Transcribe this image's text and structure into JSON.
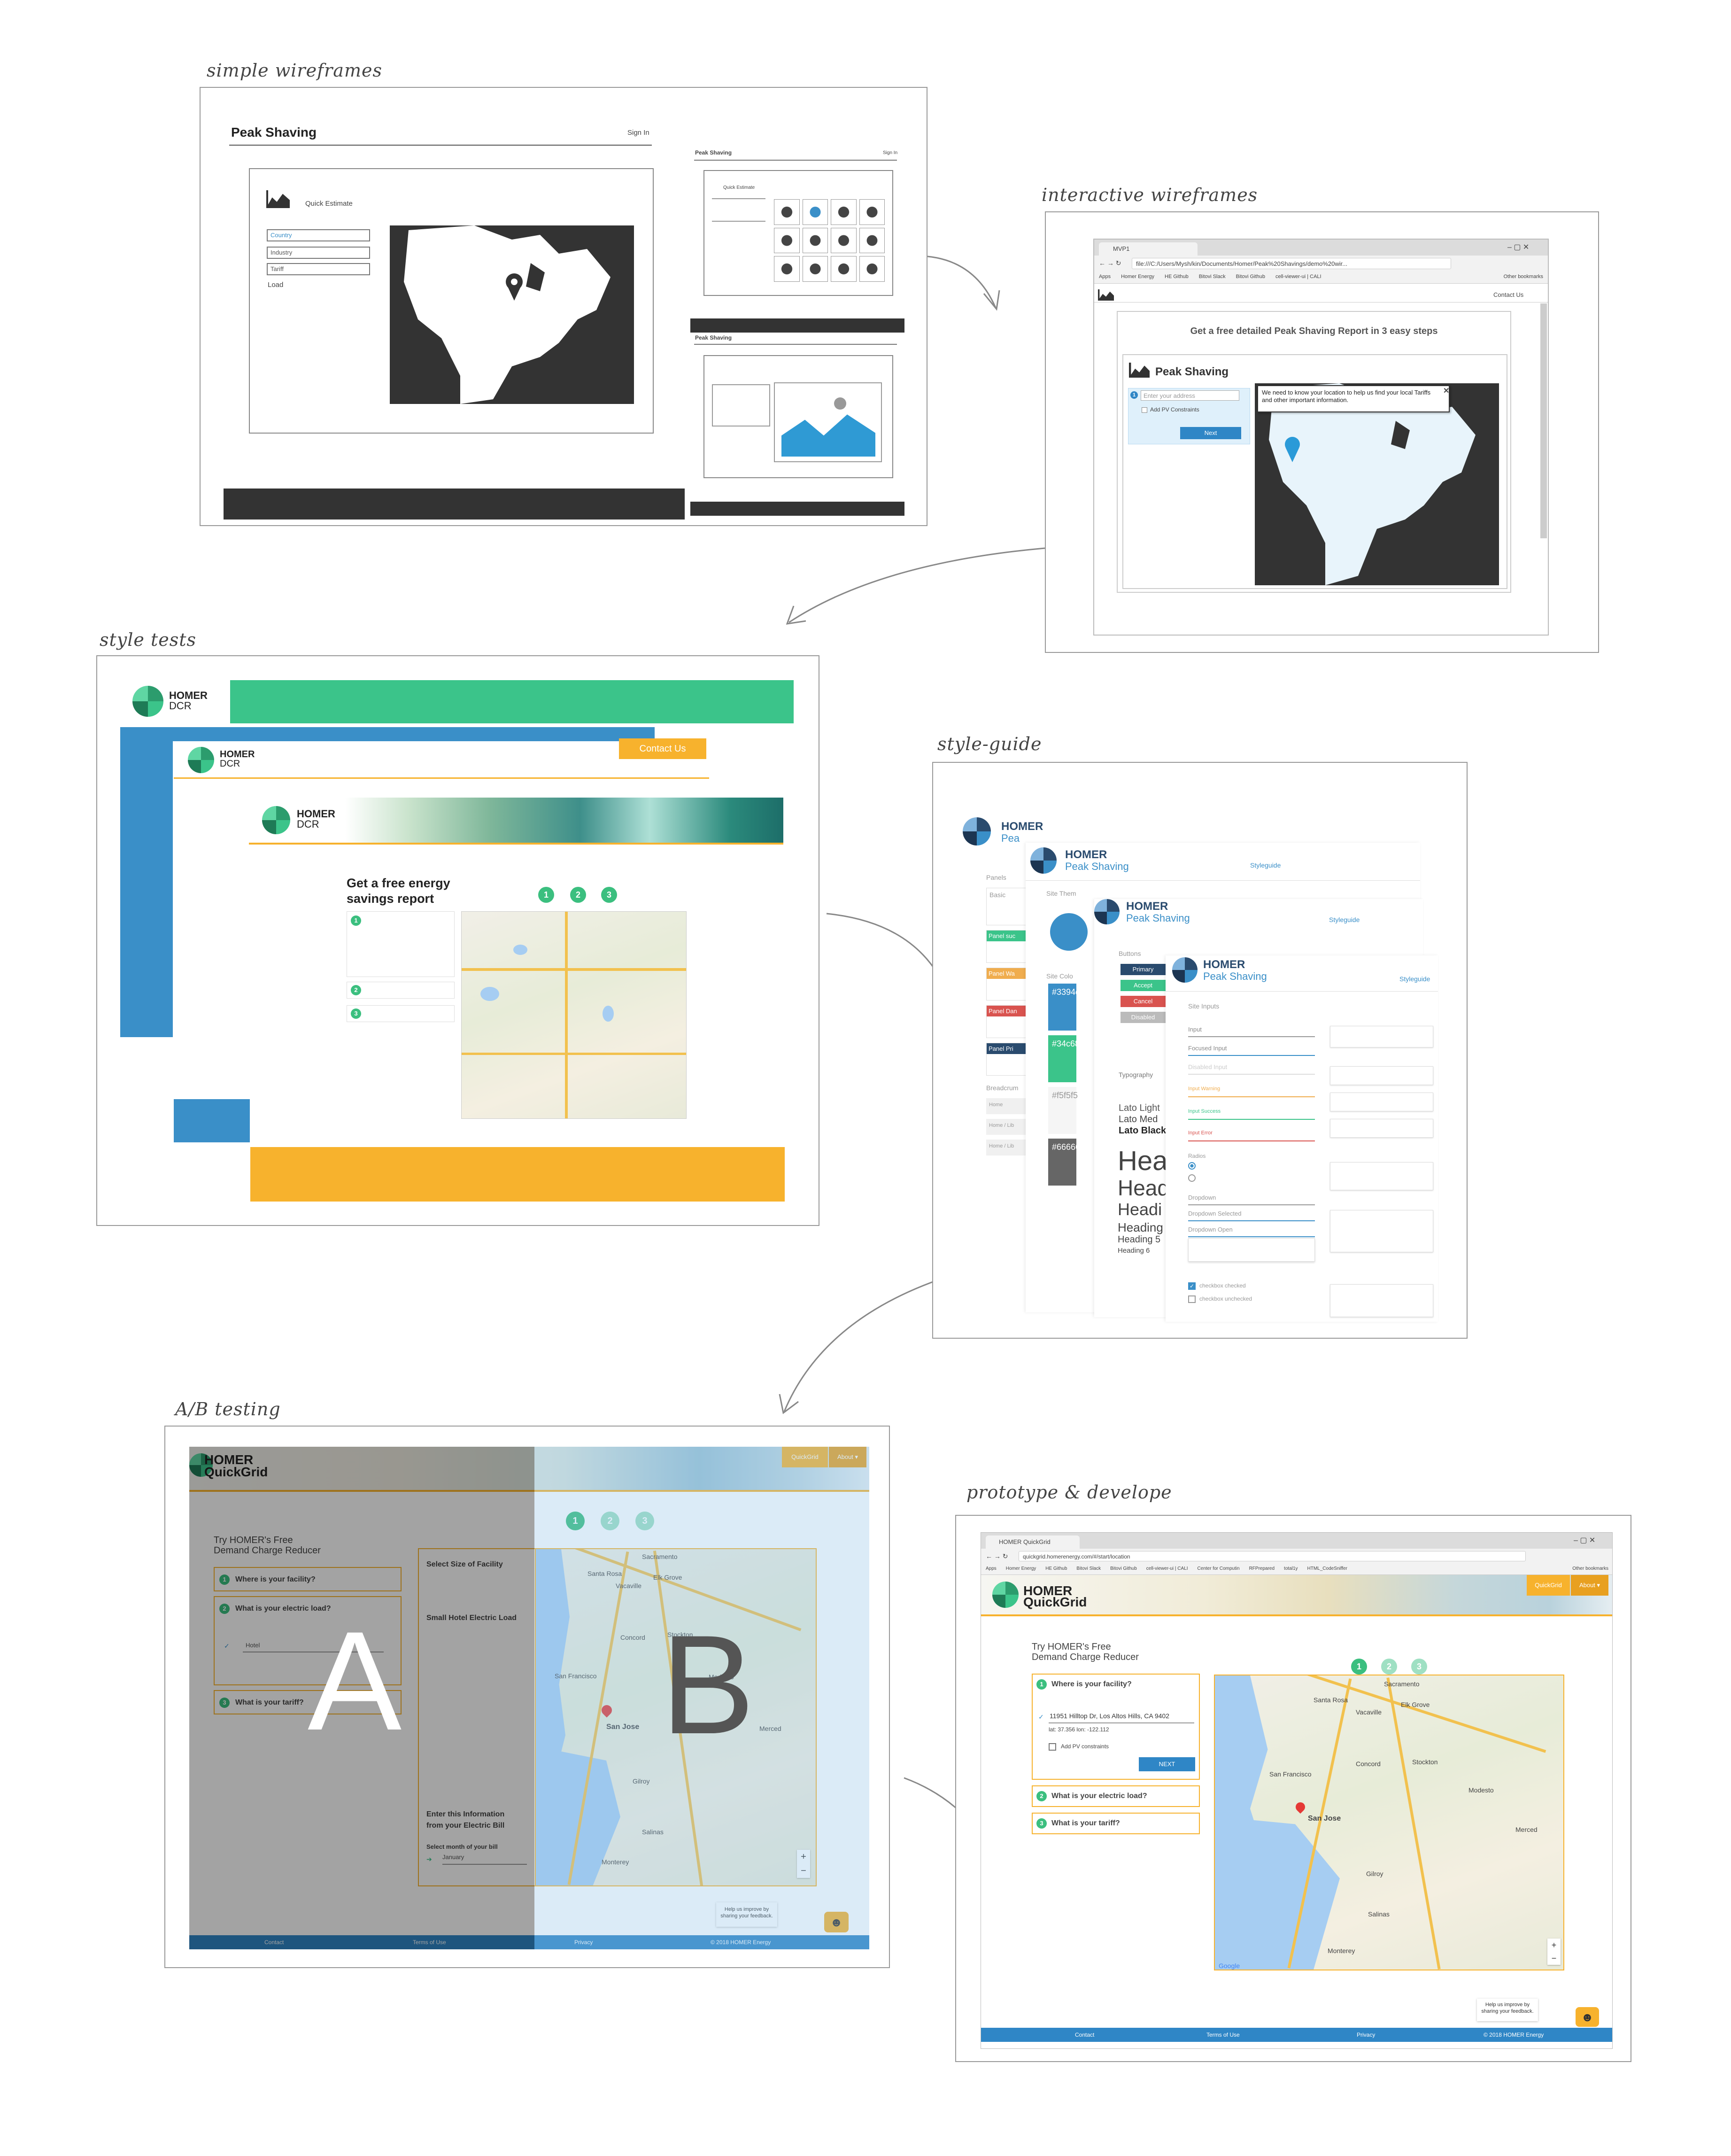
{
  "captions": {
    "simple_wireframes": "simple wireframes",
    "interactive_wireframes": "interactive wireframes",
    "style_tests": "style tests",
    "style_guide": "style-guide",
    "ab_testing": "A/B testing",
    "prototype": "prototype & develope"
  },
  "wireframe": {
    "title": "Peak Shaving",
    "sign_in": "Sign In",
    "quick_estimate": "Quick Estimate",
    "fields": [
      "Country",
      "Industry",
      "Tariff",
      "Load"
    ],
    "small_title": "Peak Shaving",
    "small_sign_in": "Sign In"
  },
  "interactive": {
    "tab_title": "MVP1",
    "url": "file:///C:/Users/Mysh/kin/Documents/Homer/Peak%20Shavings/demo%20wir...",
    "bookmarks": [
      "Apps",
      "Homer Energy",
      "HE Github",
      "Bitovi Slack",
      "Bitovi Github",
      "cell-viewer-ui | CALI"
    ],
    "other_bookmarks": "Other bookmarks",
    "contact": "Contact Us",
    "headline": "Get a free detailed Peak Shaving Report in 3 easy steps",
    "card_title": "Peak Shaving",
    "address_placeholder": "Enter your address",
    "add_pv": "Add PV Constraints",
    "next": "Next",
    "tooltip": "We need to know your location to help us find your local Tariffs and other important information."
  },
  "style_tests": {
    "brand_top": "HOMER",
    "brand_bottom": "DCR",
    "contact": "Contact Us",
    "headline": "Get a free energy savings report",
    "steps": [
      "1",
      "2",
      "3"
    ]
  },
  "style_guide": {
    "brand_top": "HOMER",
    "brand_bottom": "Peak Shaving",
    "brand_bottom_short": "Pea",
    "link": "Styleguide",
    "panels_label": "Panels",
    "panels": [
      "Basic",
      "Panel suc",
      "Panel Wa",
      "Panel Dan",
      "Panel Pri"
    ],
    "buttons_label": "Buttons",
    "buttons": [
      "Primary",
      "Accept",
      "Cancel",
      "Disabled"
    ],
    "site_theme": "Site Them",
    "site_colors": "Site Colo",
    "swatches": [
      "#3394c",
      "#34c68",
      "#f5f5f5",
      "#66666"
    ],
    "typography": "Typography",
    "lato": [
      "Lato Light",
      "Lato Med",
      "Lato Black"
    ],
    "headings": [
      "Hea",
      "Head",
      "Headi",
      "Heading",
      "Heading 5",
      "Heading 6"
    ],
    "breadcrumbs": "Breadcrum",
    "crumbs": [
      "Home",
      "Home / Lib",
      "Home / Lib"
    ],
    "site_inputs": "Site Inputs",
    "inputs": [
      "Input",
      "Focused Input",
      "Disabled Input",
      "Input Warning",
      "Input Success",
      "Input Error"
    ],
    "radios": "Radios",
    "dropdowns": [
      "Dropdown",
      "Dropdown Selected",
      "Dropdown Open"
    ],
    "checkboxes": [
      "checkbox checked",
      "checkbox unchecked"
    ]
  },
  "ab": {
    "brand_top": "HOMER",
    "brand_bottom": "QuickGrid",
    "nav_quickgrid": "QuickGrid",
    "nav_about": "About ▾",
    "try_line1": "Try HOMER's Free",
    "try_line2": "Demand Charge Reducer",
    "q1": "Where is your facility?",
    "q2": "What is your electric load?",
    "q3": "What is your tariff?",
    "load_value": "Hotel",
    "b_facility": "Select Size of Facility",
    "b_load": "Small Hotel Electric Load",
    "b_enter1": "Enter this Information",
    "b_enter2": "from your Electric Bill",
    "b_month_label": "Select month of your bill",
    "b_month": "January",
    "steps": [
      "1",
      "2",
      "3"
    ],
    "letter_a": "A",
    "letter_b": "B",
    "footer": [
      "Contact",
      "Terms of Use",
      "Privacy",
      "© 2018 HOMER Energy"
    ],
    "feedback": "Help us improve by sharing your feedback.",
    "cities": [
      "Sacramento",
      "Santa Rosa",
      "Vacaville",
      "Elk Grove",
      "Concord",
      "Stockton",
      "San Francisco",
      "Modesto",
      "San Jose",
      "Gilroy",
      "Salinas",
      "Merced",
      "Monterey"
    ]
  },
  "prototype": {
    "tab_title": "HOMER QuickGrid",
    "url": "quickgrid.homerenergy.com/#/start/location",
    "bookmarks": [
      "Apps",
      "Homer Energy",
      "HE Github",
      "Bitovi Slack",
      "Bitovi Github",
      "cell-viewer-ui | CALI",
      "Center for Computin",
      "RFPrepared",
      "total1y",
      "HTML_CodeSniffer"
    ],
    "other_bookmarks": "Other bookmarks",
    "brand_top": "HOMER",
    "brand_bottom": "QuickGrid",
    "nav_quickgrid": "QuickGrid",
    "nav_about": "About ▾",
    "try_line1": "Try HOMER's Free",
    "try_line2": "Demand Charge Reducer",
    "q1": "Where is your facility?",
    "address": "11951 Hilltop Dr, Los Altos Hills, CA 9402",
    "latlon": "lat: 37.356 lon: -122.112",
    "add_pv": "Add PV constraints",
    "next": "NEXT",
    "q2": "What is your electric load?",
    "q3": "What is your tariff?",
    "steps": [
      "1",
      "2",
      "3"
    ],
    "footer": [
      "Contact",
      "Terms of Use",
      "Privacy",
      "© 2018 HOMER Energy"
    ],
    "feedback": "Help us improve by sharing your feedback.",
    "google": "Google"
  },
  "colors": {
    "green": "#3bc48a",
    "blue": "#3a8fc8",
    "orange": "#f7b22d",
    "dark": "#333333",
    "danger": "#d9534f",
    "navy": "#2a4b6e"
  }
}
